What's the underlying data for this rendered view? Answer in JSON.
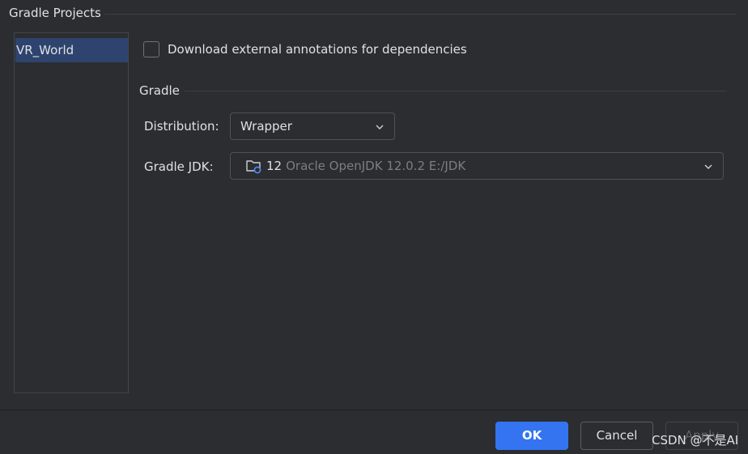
{
  "header": {
    "title": "Gradle Projects"
  },
  "projects": {
    "items": [
      {
        "label": "VR_World",
        "selected": true
      }
    ]
  },
  "options": {
    "download_annotations_label": "Download external annotations for dependencies",
    "download_annotations_checked": false
  },
  "gradle": {
    "group_title": "Gradle",
    "distribution_label": "Distribution:",
    "distribution_value": "Wrapper",
    "jdk_label": "Gradle JDK:",
    "jdk_version": "12",
    "jdk_description": "Oracle OpenJDK 12.0.2 E:/JDK",
    "jdk_icon": "folder-java-icon"
  },
  "buttons": {
    "ok_label": "OK",
    "cancel_label": "Cancel",
    "apply_label": "Apply"
  },
  "watermark": {
    "text": "CSDN @不是AI"
  },
  "colors": {
    "background": "#2b2d30",
    "selection": "#2e436e",
    "accent": "#3574f0",
    "muted_text": "#7a7e85"
  }
}
